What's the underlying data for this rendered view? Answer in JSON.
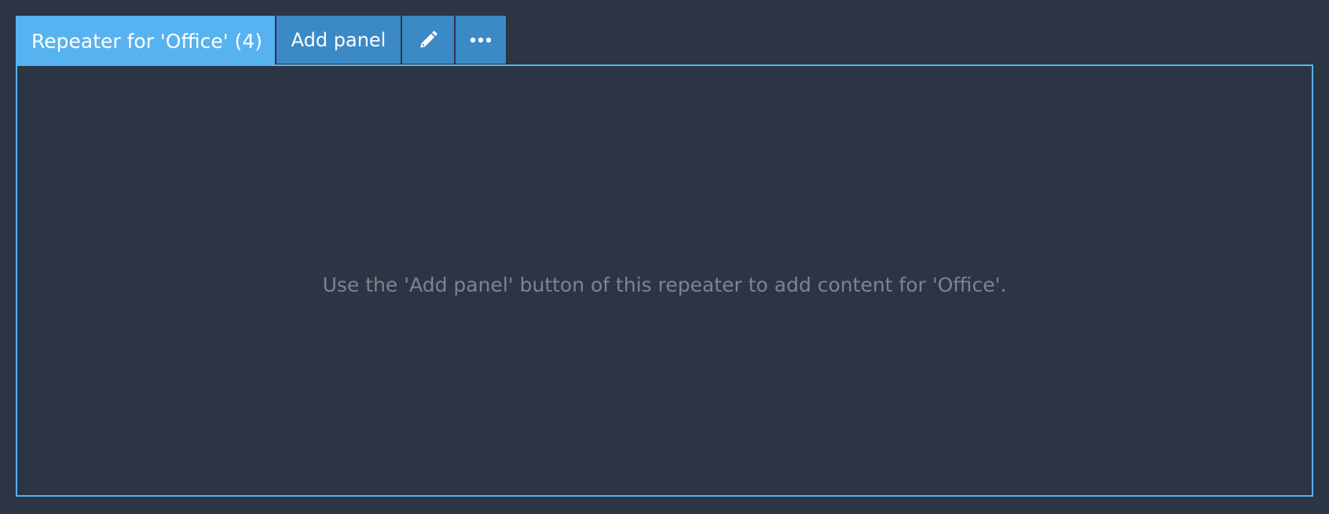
{
  "repeater": {
    "title": "Repeater for 'Office' (4)",
    "add_panel_label": "Add panel",
    "edit_icon": "pencil-icon",
    "more_icon": "ellipsis-icon",
    "empty_message": "Use the 'Add panel' button of this repeater to add content for 'Office'."
  },
  "colors": {
    "background": "#2c3543",
    "accent": "#57b2f0",
    "button": "#3b8ac6",
    "muted_text": "#7b8592"
  }
}
